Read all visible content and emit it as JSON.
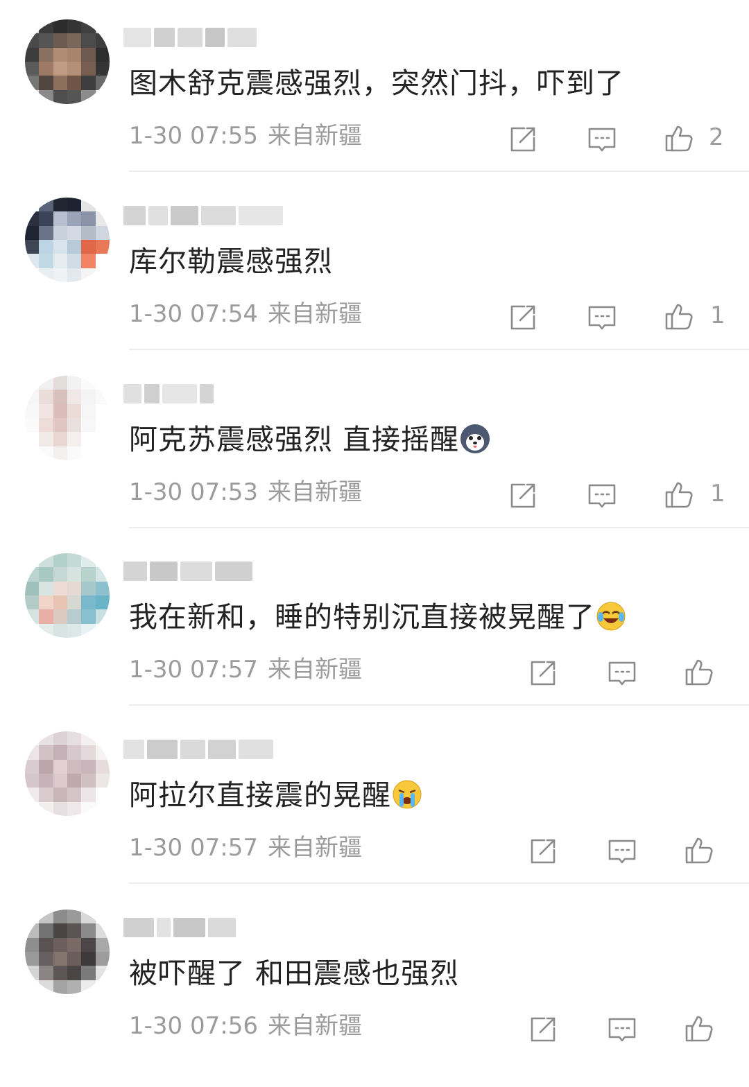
{
  "comments": [
    {
      "username": "",
      "text": "图木舒克震感强烈，突然门抖，吓到了",
      "emoji": "",
      "time": "1-30 07:55",
      "location": "来自新疆",
      "like_count": "2"
    },
    {
      "username": "",
      "text": "库尔勒震感强烈",
      "emoji": "",
      "time": "1-30 07:54",
      "location": "来自新疆",
      "like_count": "1"
    },
    {
      "username": "",
      "text": "阿克苏震感强烈 直接摇醒",
      "emoji": "husky-dog-emoji",
      "time": "1-30 07:53",
      "location": "来自新疆",
      "like_count": "1"
    },
    {
      "username": "",
      "text": "我在新和，睡的特别沉直接被晃醒了",
      "emoji": "laughing-tears-emoji",
      "time": "1-30 07:57",
      "location": "来自新疆",
      "like_count": ""
    },
    {
      "username": "",
      "text": "阿拉尔直接震的晃醒",
      "emoji": "crying-emoji",
      "time": "1-30 07:57",
      "location": "来自新疆",
      "like_count": ""
    },
    {
      "username": "",
      "text": "被吓醒了 和田震感也强烈",
      "emoji": "",
      "time": "1-30 07:56",
      "location": "来自新疆",
      "like_count": ""
    }
  ],
  "icons": {
    "share": "share-icon",
    "reply": "comment-icon",
    "like": "thumbs-up-icon"
  },
  "colors": {
    "text": "#222222",
    "meta": "#9b9b9b",
    "icon": "#8a8a8a",
    "divider": "#ececec"
  }
}
